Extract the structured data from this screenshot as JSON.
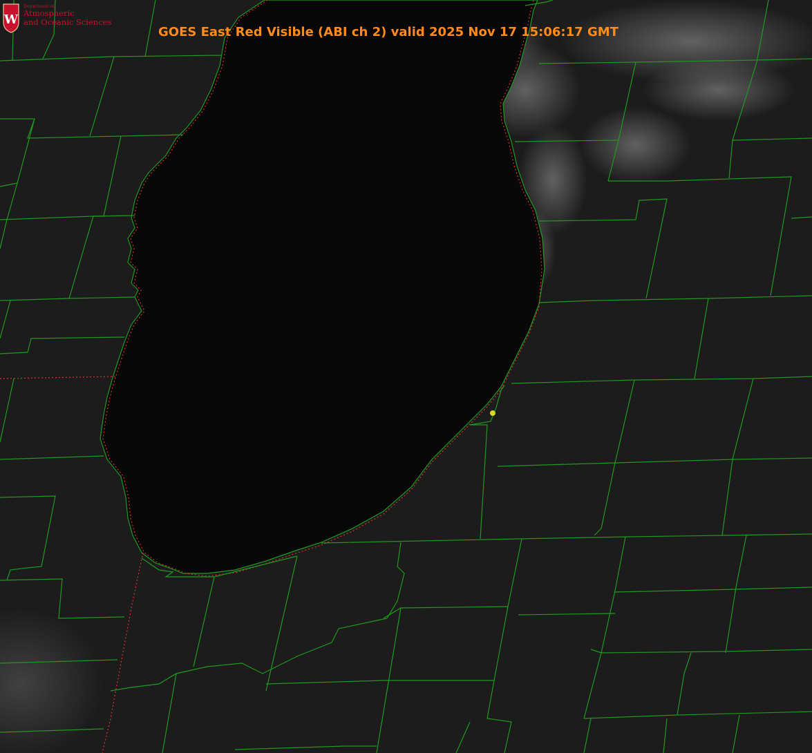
{
  "title": "GOES East Red Visible (ABI ch 2) valid 2025 Nov 17 15:06:17 GMT",
  "logo": {
    "dept_line": "Department of",
    "line1": "Atmospheric",
    "line2": "and Oceanic Sciences",
    "shield_letter": "W"
  },
  "colors": {
    "title": "#ff8c1a",
    "county_lines": "#1f9a1f",
    "state_border": "#e03030",
    "marker": "#d8d820",
    "logo_red": "#c8102e",
    "lake": "#080808",
    "land": "#1c1c1c"
  },
  "layers": [
    "visible-satellite-imagery",
    "county-boundaries",
    "state-boundaries",
    "lake-michigan-shoreline",
    "location-marker"
  ]
}
